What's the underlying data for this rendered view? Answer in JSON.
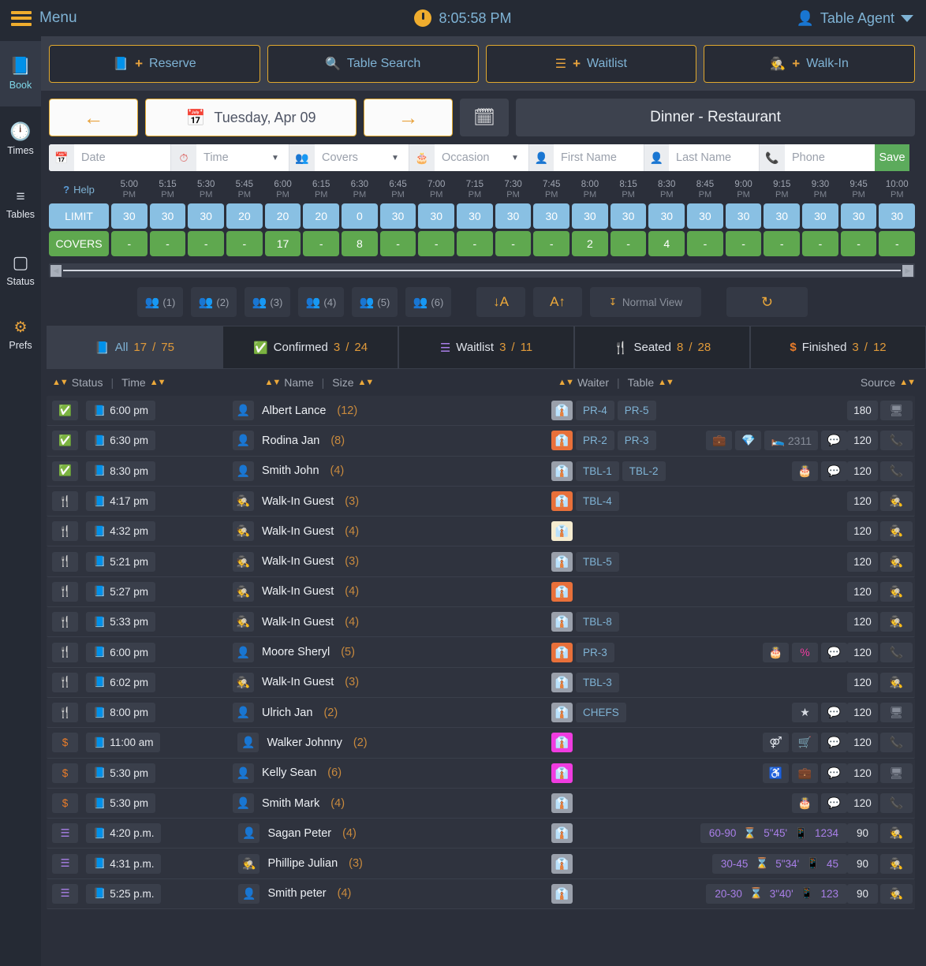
{
  "topbar": {
    "menu_label": "Menu",
    "clock": "8:05:58 PM",
    "user": "Table Agent",
    "menu_icon": "hamburger-icon",
    "clock_icon": "clock-icon",
    "user_icon": "user-icon"
  },
  "actions": [
    {
      "label": "Reserve",
      "icon": "book-icon",
      "plus": "+"
    },
    {
      "label": "Table Search",
      "icon": "search-icon",
      "plus": ""
    },
    {
      "label": "Waitlist",
      "icon": "list-icon",
      "plus": "+"
    },
    {
      "label": "Walk-In",
      "icon": "walkin-icon",
      "plus": "+"
    }
  ],
  "datebar": {
    "prev": "←",
    "next": "→",
    "date": "Tuesday, Apr 09",
    "calendar_icon": "calendar-icon",
    "calendar_check_icon": "calendar-check-icon",
    "service": "Dinner - Restaurant"
  },
  "filters": {
    "date_placeholder": "Date",
    "time_placeholder": "Time",
    "covers_placeholder": "Covers",
    "occasion_placeholder": "Occasion",
    "first_name_placeholder": "First Name",
    "last_name_placeholder": "Last Name",
    "phone_placeholder": "Phone",
    "save_label": "Save"
  },
  "timegrid": {
    "help_label": "Help",
    "limit_label": "LIMIT",
    "covers_label": "COVERS",
    "slots": [
      "5:00",
      "5:15",
      "5:30",
      "5:45",
      "6:00",
      "6:15",
      "6:30",
      "6:45",
      "7:00",
      "7:15",
      "7:30",
      "7:45",
      "8:00",
      "8:15",
      "8:30",
      "8:45",
      "9:00",
      "9:15",
      "9:30",
      "9:45",
      "10:00"
    ],
    "meridiem": [
      "PM",
      "PM",
      "PM",
      "PM",
      "PM",
      "PM",
      "PM",
      "PM",
      "PM",
      "PM",
      "PM",
      "PM",
      "PM",
      "PM",
      "PM",
      "PM",
      "PM",
      "PM",
      "PM",
      "PM",
      "PM"
    ],
    "limits": [
      "30",
      "30",
      "30",
      "20",
      "20",
      "20",
      "0",
      "30",
      "30",
      "30",
      "30",
      "30",
      "30",
      "30",
      "30",
      "30",
      "30",
      "30",
      "30",
      "30",
      "30"
    ],
    "covers": [
      "-",
      "-",
      "-",
      "-",
      "17",
      "-",
      "8",
      "-",
      "-",
      "-",
      "-",
      "-",
      "2",
      "-",
      "4",
      "-",
      "-",
      "-",
      "-",
      "-",
      "-"
    ]
  },
  "tools": {
    "party_sizes": [
      "(1)",
      "(2)",
      "(3)",
      "(4)",
      "(5)",
      "(6)"
    ],
    "sort_desc": "↓A",
    "sort_asc": "A↑",
    "view_label": "Normal View",
    "refresh_icon": "refresh-icon"
  },
  "tabs": [
    {
      "label": "All",
      "count": "17",
      "sep": "/",
      "total": "75",
      "icon": "book-icon",
      "active": true
    },
    {
      "label": "Confirmed",
      "count": "3",
      "sep": "/",
      "total": "24",
      "icon": "check-icon",
      "active": false
    },
    {
      "label": "Waitlist",
      "count": "3",
      "sep": "/",
      "total": "11",
      "icon": "list-icon",
      "active": false
    },
    {
      "label": "Seated",
      "count": "8",
      "sep": "/",
      "total": "28",
      "icon": "cutlery-icon",
      "active": false
    },
    {
      "label": "Finished",
      "count": "3",
      "sep": "/",
      "total": "12",
      "icon": "dollar-icon",
      "active": false
    }
  ],
  "columns": {
    "status": "Status",
    "time": "Time",
    "name": "Name",
    "size": "Size",
    "waiter": "Waiter",
    "table": "Table",
    "source": "Source"
  },
  "rows": [
    {
      "status": "confirmed",
      "time": "6:00 pm",
      "guest_type": "person",
      "name": "Albert Lance",
      "size": "(12)",
      "tie": "gray",
      "tables": [
        "PR-4",
        "PR-5"
      ],
      "icons": [],
      "duration": "180",
      "source": "monitor"
    },
    {
      "status": "confirmed",
      "time": "6:30 pm",
      "guest_type": "person",
      "name": "Rodina Jan",
      "size": "(8)",
      "tie": "orange",
      "tables": [
        "PR-2",
        "PR-3"
      ],
      "icons": [
        "briefcase",
        "diamond",
        "bed:2311",
        "comment"
      ],
      "duration": "120",
      "source": "phone"
    },
    {
      "status": "confirmed",
      "time": "8:30 pm",
      "guest_type": "person",
      "name": "Smith John",
      "size": "(4)",
      "tie": "gray",
      "tables": [
        "TBL-1",
        "TBL-2"
      ],
      "icons": [
        "cake",
        "comment"
      ],
      "duration": "120",
      "source": "phone"
    },
    {
      "status": "seated",
      "time": "4:17 pm",
      "guest_type": "walkin",
      "name": "Walk-In Guest",
      "size": "(3)",
      "tie": "orange",
      "tables": [
        "TBL-4"
      ],
      "icons": [],
      "duration": "120",
      "source": "walkin"
    },
    {
      "status": "seated",
      "time": "4:32 pm",
      "guest_type": "walkin",
      "name": "Walk-In Guest",
      "size": "(4)",
      "tie": "cream",
      "tables": [],
      "icons": [],
      "duration": "120",
      "source": "walkin"
    },
    {
      "status": "seated",
      "time": "5:21 pm",
      "guest_type": "walkin",
      "name": "Walk-In Guest",
      "size": "(3)",
      "tie": "gray",
      "tables": [
        "TBL-5"
      ],
      "icons": [],
      "duration": "120",
      "source": "walkin"
    },
    {
      "status": "seated",
      "time": "5:27 pm",
      "guest_type": "walkin",
      "name": "Walk-In Guest",
      "size": "(4)",
      "tie": "orange",
      "tables": [],
      "icons": [],
      "duration": "120",
      "source": "walkin"
    },
    {
      "status": "seated",
      "time": "5:33 pm",
      "guest_type": "walkin",
      "name": "Walk-In Guest",
      "size": "(4)",
      "tie": "gray",
      "tables": [
        "TBL-8"
      ],
      "icons": [],
      "duration": "120",
      "source": "walkin"
    },
    {
      "status": "seated",
      "time": "6:00 pm",
      "guest_type": "person",
      "name": "Moore Sheryl",
      "size": "(5)",
      "tie": "orange",
      "tables": [
        "PR-3"
      ],
      "icons": [
        "cake",
        "percent",
        "comment"
      ],
      "duration": "120",
      "source": "phone"
    },
    {
      "status": "seated",
      "time": "6:02 pm",
      "guest_type": "walkin",
      "name": "Walk-In Guest",
      "size": "(3)",
      "tie": "gray",
      "tables": [
        "TBL-3"
      ],
      "icons": [],
      "duration": "120",
      "source": "walkin"
    },
    {
      "status": "seated",
      "time": "8:00 pm",
      "guest_type": "person",
      "name": "Ulrich Jan",
      "size": "(2)",
      "tie": "gray",
      "tables": [
        "CHEFS"
      ],
      "icons": [
        "star",
        "comment"
      ],
      "duration": "120",
      "source": "monitor"
    },
    {
      "status": "finished",
      "time": "11:00 am",
      "guest_type": "person",
      "name": "Walker Johnny",
      "size": "(2)",
      "tie": "magenta",
      "tables": [],
      "icons": [
        "gender",
        "basket",
        "comment"
      ],
      "duration": "120",
      "source": "phone"
    },
    {
      "status": "finished",
      "time": "5:30 pm",
      "guest_type": "person",
      "name": "Kelly Sean",
      "size": "(6)",
      "tie": "magenta",
      "tables": [],
      "icons": [
        "wheelchair",
        "briefcase",
        "comment"
      ],
      "duration": "120",
      "source": "monitor"
    },
    {
      "status": "finished",
      "time": "5:30 pm",
      "guest_type": "person",
      "name": "Smith Mark",
      "size": "(4)",
      "tie": "gray",
      "tables": [],
      "icons": [
        "cake",
        "comment"
      ],
      "duration": "120",
      "source": "phone"
    },
    {
      "status": "waitlist",
      "time": "4:20 p.m.",
      "guest_type": "person",
      "name": "Sagan Peter",
      "size": "(4)",
      "tie": "gray",
      "tables": [],
      "wait": {
        "range": "60-90",
        "elapsed": "5\"45'",
        "pager": "1234"
      },
      "icons": [],
      "duration": "90",
      "source": "walkin"
    },
    {
      "status": "waitlist",
      "time": "4:31 p.m.",
      "guest_type": "walkin",
      "name": "Phillipe Julian",
      "size": "(3)",
      "tie": "gray",
      "tables": [],
      "wait": {
        "range": "30-45",
        "elapsed": "5\"34'",
        "pager": "45"
      },
      "icons": [],
      "duration": "90",
      "source": "walkin"
    },
    {
      "status": "waitlist",
      "time": "5:25 p.m.",
      "guest_type": "person",
      "name": "Smith peter",
      "size": "(4)",
      "tie": "gray",
      "tables": [],
      "wait": {
        "range": "20-30",
        "elapsed": "3\"40'",
        "pager": "123"
      },
      "icons": [],
      "duration": "90",
      "source": "walkin"
    }
  ],
  "sidebar": {
    "items": [
      {
        "label": "Book",
        "icon": "book-icon",
        "active": true
      },
      {
        "label": "Times",
        "icon": "clock-icon",
        "active": false
      },
      {
        "label": "Tables",
        "icon": "numbered-list-icon",
        "active": false
      },
      {
        "label": "Status",
        "icon": "square-icon",
        "active": false
      },
      {
        "label": "Prefs",
        "icon": "gear-icon",
        "active": false
      }
    ]
  },
  "colors": {
    "accent": "#e8a33d",
    "link": "#7fb3d5",
    "limit": "#89c0e3",
    "covers": "#5fa84f",
    "save": "#5cab5c",
    "purple": "#a97fe8"
  }
}
